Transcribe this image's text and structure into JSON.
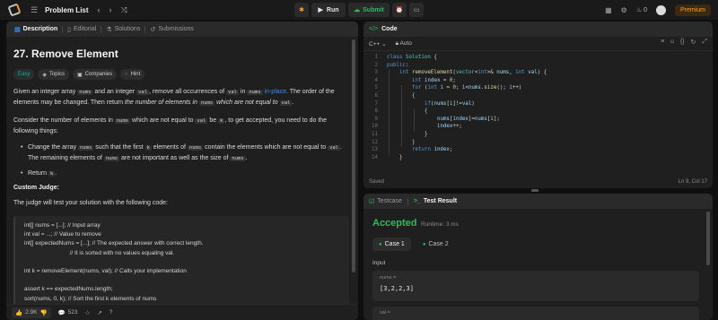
{
  "topbar": {
    "title": "Problem List",
    "run_label": "Run",
    "submit_label": "Submit",
    "streak_count": "0",
    "premium_label": "Premium"
  },
  "left_tabs": [
    "Description",
    "Editorial",
    "Solutions",
    "Submissions"
  ],
  "problem": {
    "title": "27. Remove Element",
    "difficulty": "Easy",
    "badges": [
      "Topics",
      "Companies",
      "Hint"
    ],
    "p1_a": "Given an integer array ",
    "p1_nums": "nums",
    "p1_b": " and an integer ",
    "p1_val": "val",
    "p1_c": ", remove all occurrences of ",
    "p1_val2": "val",
    "p1_d": " in ",
    "p1_nums2": "nums",
    "p1_e": " ",
    "p1_inplace": "in-place",
    "p1_f": ". The order of the elements may be changed. Then return ",
    "p1_g": "the number of elements in ",
    "p1_nums3": "nums",
    "p1_h": " which are not equal to ",
    "p1_val3": "val",
    "p1_i": ".",
    "p2_a": "Consider the number of elements in ",
    "p2_nums": "nums",
    "p2_b": " which are not equal to ",
    "p2_val": "val",
    "p2_c": " be ",
    "p2_k": "k",
    "p2_d": ", to get accepted, you need to do the following things:",
    "b1_a": "Change the array ",
    "b1_nums": "nums",
    "b1_b": " such that the first ",
    "b1_k": "k",
    "b1_c": " elements of ",
    "b1_nums2": "nums",
    "b1_d": " contain the elements which are not equal to ",
    "b1_val": "val",
    "b1_e": ". The remaining elements of ",
    "b1_nums3": "nums",
    "b1_f": " are not important as well as the size of ",
    "b1_nums4": "nums",
    "b1_g": ".",
    "b2_a": "Return ",
    "b2_k": "k",
    "b2_b": ".",
    "judge_heading": "Custom Judge:",
    "judge_text": "The judge will test your solution with the following code:",
    "judge_code": "int[] nums = [...]; // Input array\nint val = ...; // Value to remove\nint[] expectedNums = [...]; // The expected answer with correct length.\n                            // It is sorted with no values equaling val.\n\nint k = removeElement(nums, val); // Calls your implementation\n\nassert k == expectedNums.length;\nsort(nums, 0, k); // Sort the first k elements of nums"
  },
  "bottom_bar": {
    "likes": "2.9K",
    "comments": "523"
  },
  "editor": {
    "title": "Code",
    "language": "C++",
    "mode": "Auto",
    "status_left": "Saved",
    "status_right": "Ln 9, Col 17"
  },
  "code_lines": [
    {
      "n": "1",
      "indent": 0,
      "html": "<span class='kw'>class</span> <span class='ty'>Solution</span> {"
    },
    {
      "n": "2",
      "indent": 0,
      "html": "<span class='kw'>public</span>:"
    },
    {
      "n": "3",
      "indent": 1,
      "html": "<span class='kw'>int</span> <span class='fn'>removeElement</span>(<span class='ty'>vector</span>&lt;<span class='kw'>int</span>&gt;&amp; <span class='var'>nums</span>, <span class='kw'>int</span> <span class='var'>val</span>) {"
    },
    {
      "n": "4",
      "indent": 2,
      "html": "<span class='kw'>int</span> <span class='var'>index</span> = <span class='num'>0</span>;"
    },
    {
      "n": "5",
      "indent": 2,
      "html": "<span class='kw'>for</span> (<span class='kw'>int</span> <span class='var'>i</span> = <span class='num'>0</span>; <span class='var'>i</span>&lt;<span class='var'>nums</span>.<span class='fn'>size</span>(); <span class='var'>i</span>++)"
    },
    {
      "n": "6",
      "indent": 2,
      "html": "{"
    },
    {
      "n": "7",
      "indent": 3,
      "html": "<span class='kw'>if</span>(<span class='var'>nums</span>[<span class='var'>i</span>]!=<span class='var'>val</span>)"
    },
    {
      "n": "8",
      "indent": 3,
      "html": "{"
    },
    {
      "n": "9",
      "indent": 4,
      "html": "<span class='var'>nums</span>[<span class='var'>index</span>]=<span class='var'>nums</span>[<span class='var'>i</span>];"
    },
    {
      "n": "10",
      "indent": 4,
      "html": "<span class='var'>index</span>++;"
    },
    {
      "n": "11",
      "indent": 3,
      "html": "}"
    },
    {
      "n": "12",
      "indent": 2,
      "html": "}"
    },
    {
      "n": "13",
      "indent": 2,
      "html": "<span class='kw'>return</span> <span class='var'>index</span>;"
    },
    {
      "n": "14",
      "indent": 1,
      "html": "}"
    }
  ],
  "result": {
    "tab_testcase": "Testcase",
    "tab_result": "Test Result",
    "status": "Accepted",
    "runtime": "Runtime: 3 ms",
    "cases": [
      "Case 1",
      "Case 2"
    ],
    "input_label": "Input",
    "input_name": "nums =",
    "input_value": "[3,2,2,3]",
    "input2_name": "val ="
  }
}
